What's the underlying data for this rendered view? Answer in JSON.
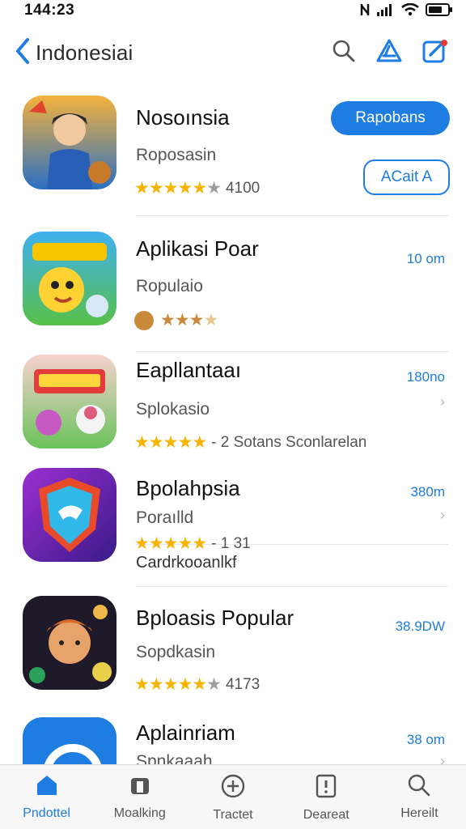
{
  "status_bar": {
    "time": "144:23"
  },
  "nav": {
    "title": "Indonesiai"
  },
  "apps": [
    {
      "name": "Nosoınsia",
      "subtitle": "Roposasin",
      "rating_text": "4100",
      "stars": 4,
      "primary_button": "Rapobans",
      "secondary_button": "ACait A",
      "size": "",
      "extra": ""
    },
    {
      "name": "Aplikasi Poar",
      "subtitle": "Ropulaio",
      "rating_text": "",
      "stars": 3,
      "size": "10 om",
      "extra": ""
    },
    {
      "name": "Eapllantaaı",
      "subtitle": "Splokasio",
      "rating_text": "- 2 Sotans Sconlarelan",
      "stars": 4,
      "size": "180no",
      "extra": ""
    },
    {
      "name": "Bpolahpsia",
      "subtitle": "Poraılld",
      "rating_text": "-  1 31",
      "stars": 4,
      "size": "380m",
      "extra": "Cardrkooanlkf"
    },
    {
      "name": "Bploasis Popular",
      "subtitle": "Sopdkasin",
      "rating_text": "4173",
      "stars": 4,
      "size": "38.9DW",
      "extra": ""
    },
    {
      "name": "Aplainriam",
      "subtitle": "Spnkaaah",
      "rating_text": "",
      "stars": 0,
      "size": "38 om",
      "extra": ""
    }
  ],
  "tabs": [
    {
      "label": "Pndottel",
      "icon": "home-icon",
      "active": true
    },
    {
      "label": "Moalking",
      "icon": "bag-icon",
      "active": false
    },
    {
      "label": "Tractet",
      "icon": "plus-circle-icon",
      "active": false
    },
    {
      "label": "Deareat",
      "icon": "alert-doc-icon",
      "active": false
    },
    {
      "label": "Hereilt",
      "icon": "search-icon",
      "active": false
    }
  ],
  "colors": {
    "accent": "#1e7de0",
    "star": "#f5b400",
    "badge": "#e53935"
  }
}
